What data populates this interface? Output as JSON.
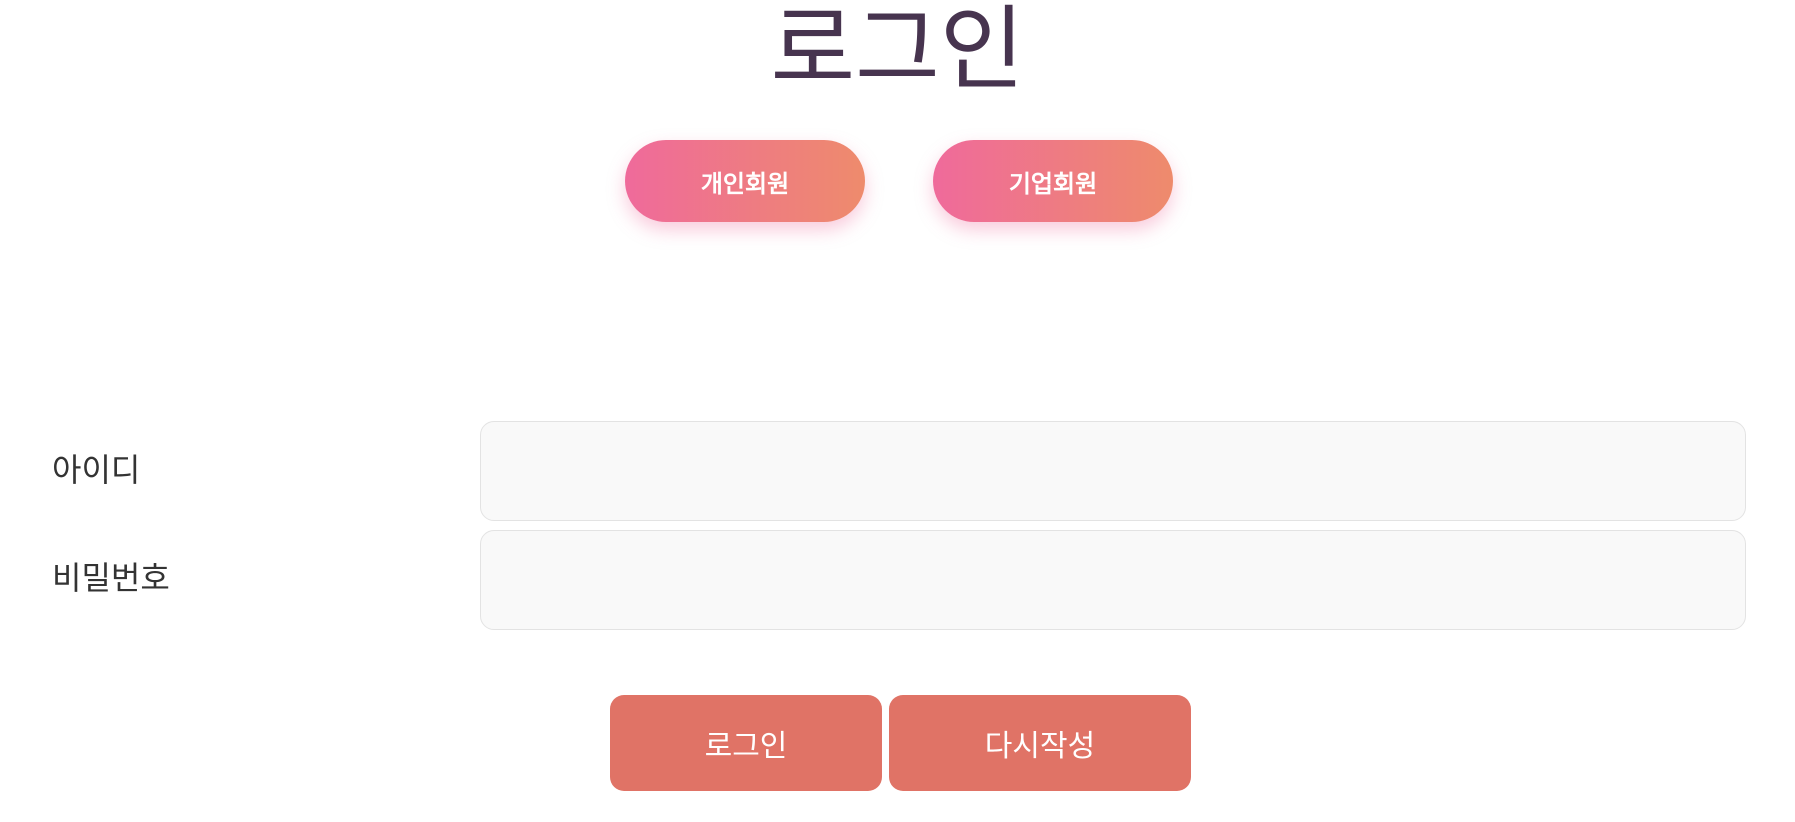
{
  "page": {
    "title": "로그인"
  },
  "member_types": {
    "personal_label": "개인회원",
    "company_label": "기업회원"
  },
  "form": {
    "id_label": "아이디",
    "id_value": "",
    "password_label": "비밀번호",
    "password_value": ""
  },
  "actions": {
    "login_label": "로그인",
    "reset_label": "다시작성"
  },
  "colors": {
    "title": "#47344f",
    "gradient_start": "#ef6a9b",
    "gradient_end": "#ee8b6c",
    "action_button": "#e07366",
    "input_background": "#f9f9f9"
  }
}
